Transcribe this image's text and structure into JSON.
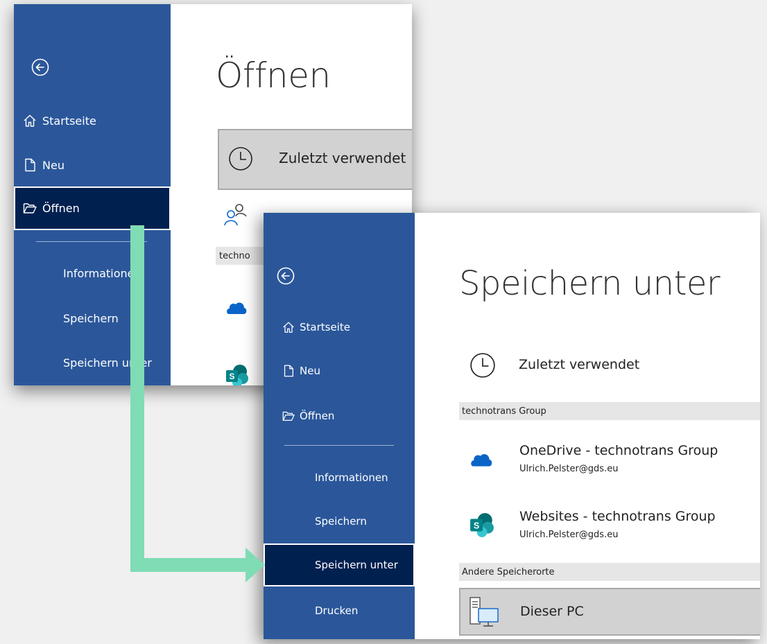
{
  "open_window": {
    "nav": {
      "back_label": "",
      "items": [
        {
          "label": "Startseite"
        },
        {
          "label": "Neu"
        },
        {
          "label": "Öffnen"
        },
        {
          "label": "Informationen"
        },
        {
          "label": "Speichern"
        },
        {
          "label": "Speichern unter"
        }
      ]
    },
    "title": "Öffnen",
    "recent_label": "Zuletzt verwendet",
    "section_label": "techno"
  },
  "save_window": {
    "nav": {
      "items": [
        {
          "label": "Startseite"
        },
        {
          "label": "Neu"
        },
        {
          "label": "Öffnen"
        },
        {
          "label": "Informationen"
        },
        {
          "label": "Speichern"
        },
        {
          "label": "Speichern unter"
        },
        {
          "label": "Drucken"
        }
      ]
    },
    "title": "Speichern unter",
    "recent_label": "Zuletzt verwendet",
    "group_header": "technotrans Group",
    "locations": [
      {
        "title": "OneDrive - technotrans Group",
        "account": "Ulrich.Pelster@gds.eu",
        "icon": "onedrive-cloud-icon"
      },
      {
        "title": "Websites - technotrans Group",
        "account": "Ulrich.Pelster@gds.eu",
        "icon": "sharepoint-icon"
      }
    ],
    "other_header": "Andere Speicherorte",
    "this_pc_label": "Dieser PC"
  },
  "colors": {
    "sidebar": "#2b579a",
    "sidebar_selected": "#002050",
    "arrow": "#7fdcb5",
    "onedrive": "#0a64c8",
    "sharepoint": "#038387"
  }
}
